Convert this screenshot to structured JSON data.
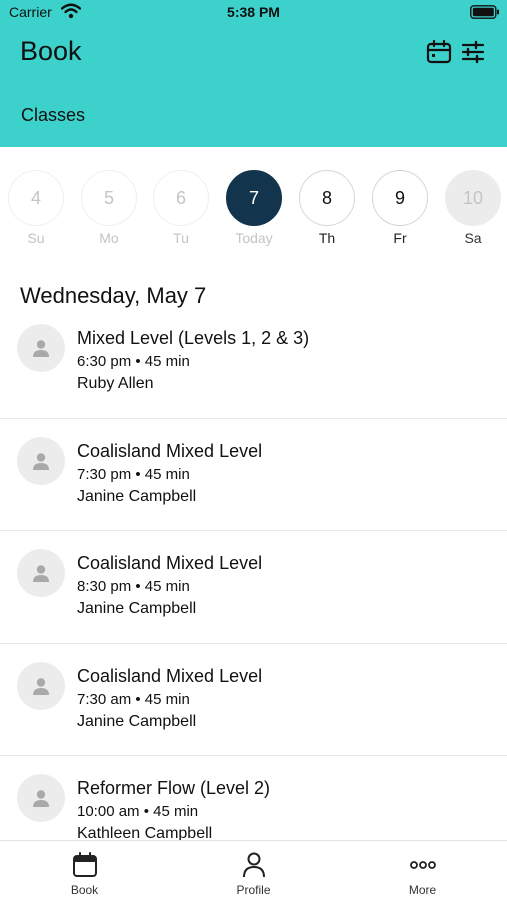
{
  "status_bar": {
    "carrier": "Carrier",
    "time": "5:38 PM"
  },
  "header": {
    "title": "Book",
    "subtitle": "Classes",
    "icons": [
      "calendar-icon",
      "filter-icon"
    ],
    "background": "#3dd1cb"
  },
  "days": [
    {
      "num": "4",
      "label": "Su",
      "state": "past"
    },
    {
      "num": "5",
      "label": "Mo",
      "state": "past"
    },
    {
      "num": "6",
      "label": "Tu",
      "state": "past"
    },
    {
      "num": "7",
      "label": "Today",
      "state": "selected"
    },
    {
      "num": "8",
      "label": "Th",
      "state": "available"
    },
    {
      "num": "9",
      "label": "Fr",
      "state": "available"
    },
    {
      "num": "10",
      "label": "Sa",
      "state": "disabled"
    }
  ],
  "date_heading": "Wednesday, May 7",
  "classes": [
    {
      "name": "Mixed Level (Levels 1, 2 & 3)",
      "time": "6:30 pm • 45 min",
      "teacher": "Ruby Allen"
    },
    {
      "name": "Coalisland Mixed Level",
      "time": "7:30 pm • 45 min",
      "teacher": "Janine Campbell"
    },
    {
      "name": "Coalisland Mixed Level",
      "time": "8:30 pm • 45 min",
      "teacher": "Janine Campbell"
    },
    {
      "name": "Coalisland Mixed Level",
      "time": "7:30 am • 45 min",
      "teacher": "Janine Campbell"
    },
    {
      "name": "Reformer Flow (Level 2)",
      "time": "10:00 am • 45 min",
      "teacher": "Kathleen Campbell"
    }
  ],
  "tabs": [
    {
      "label": "Book",
      "icon": "calendar-icon"
    },
    {
      "label": "Profile",
      "icon": "person-icon"
    },
    {
      "label": "More",
      "icon": "more-icon"
    }
  ],
  "colors": {
    "accent": "#3dd1cb",
    "selected_day": "#12344d"
  }
}
